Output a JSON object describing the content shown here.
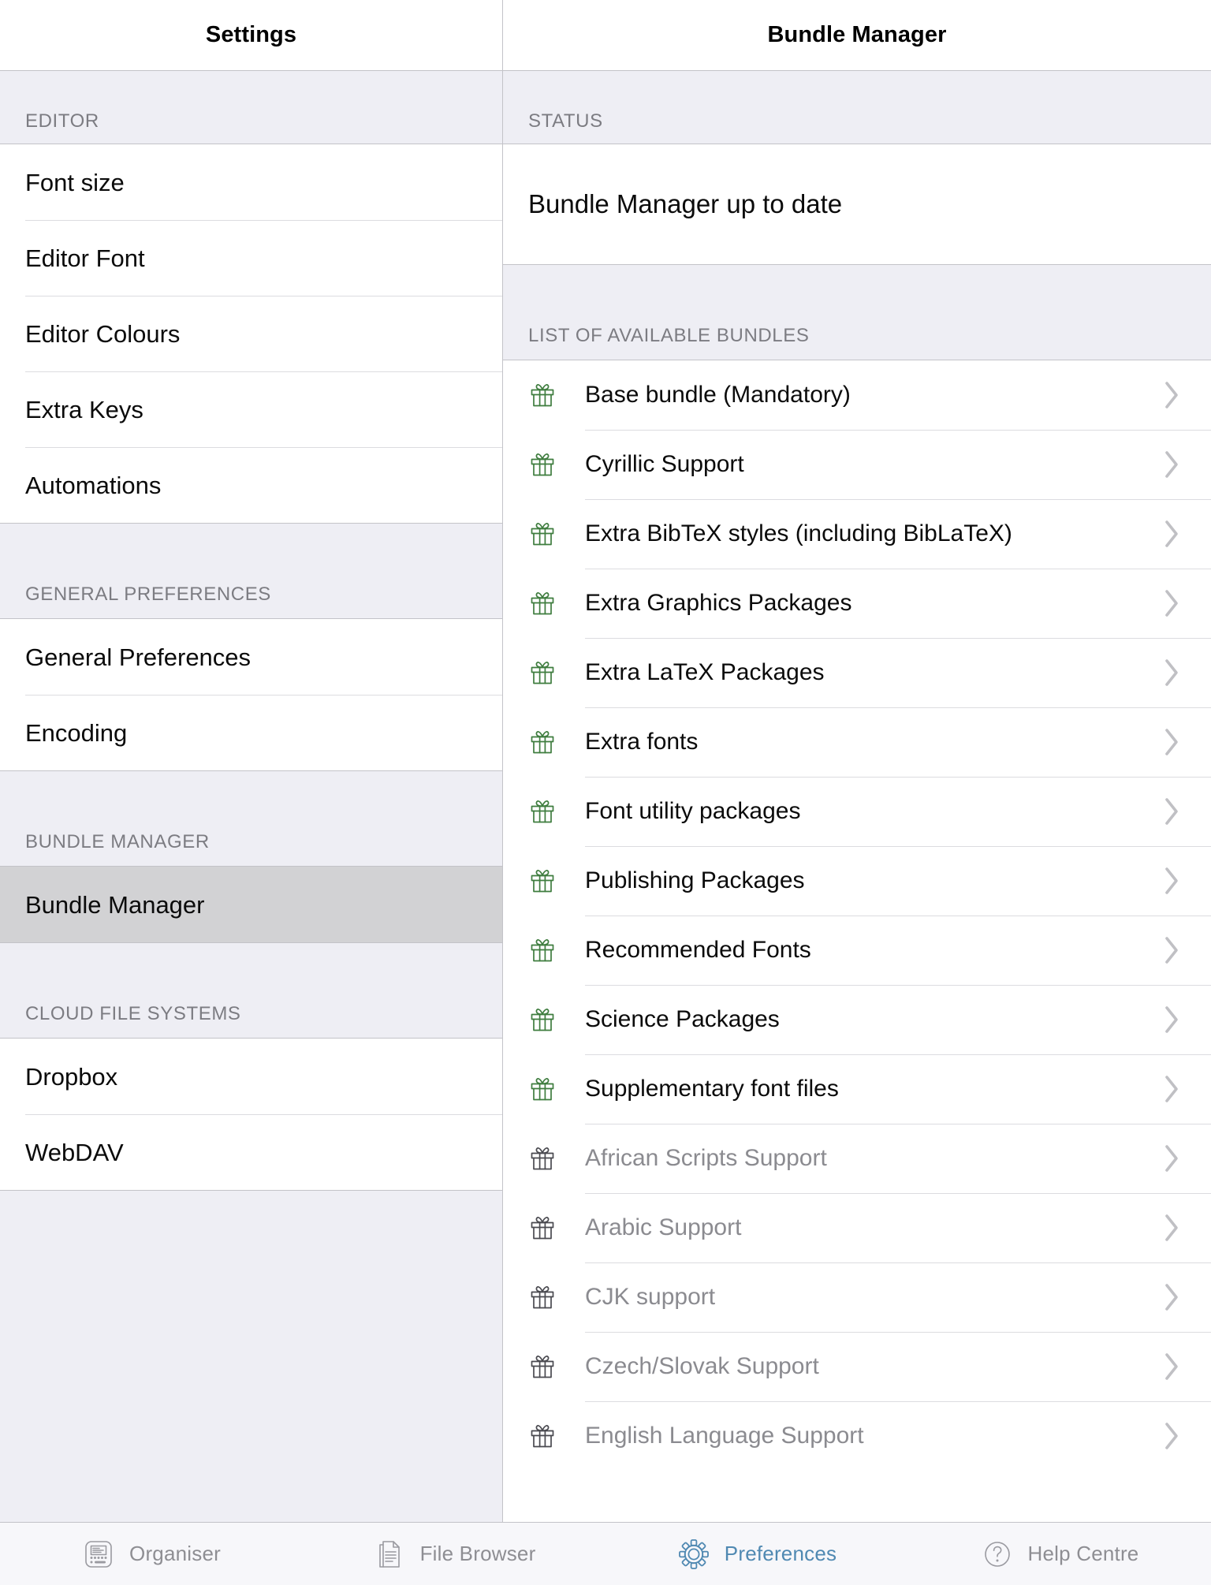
{
  "colors": {
    "accent": "#5089b2",
    "gift_installed": "#3f7d3f",
    "gift_available": "#4a4a50",
    "selected_row": "#d2d2d4",
    "group_bg": "#eeeef4",
    "separator": "#c3c3c8",
    "muted_text": "#8b8b90",
    "section_header_text": "#7c7c82",
    "chevron": "#c0c0c4"
  },
  "left_pane": {
    "nav_title": "Settings",
    "sections": [
      {
        "header": "EDITOR",
        "rows": [
          {
            "label": "Font size",
            "selected": false
          },
          {
            "label": "Editor Font",
            "selected": false
          },
          {
            "label": "Editor Colours",
            "selected": false
          },
          {
            "label": "Extra Keys",
            "selected": false
          },
          {
            "label": "Automations",
            "selected": false
          }
        ]
      },
      {
        "header": "GENERAL PREFERENCES",
        "rows": [
          {
            "label": "General Preferences",
            "selected": false
          },
          {
            "label": "Encoding",
            "selected": false
          }
        ]
      },
      {
        "header": "BUNDLE MANAGER",
        "rows": [
          {
            "label": "Bundle Manager",
            "selected": true
          }
        ]
      },
      {
        "header": "CLOUD FILE SYSTEMS",
        "rows": [
          {
            "label": "Dropbox",
            "selected": false
          },
          {
            "label": "WebDAV",
            "selected": false
          }
        ]
      }
    ]
  },
  "right_pane": {
    "nav_title": "Bundle Manager",
    "status_header": "STATUS",
    "status_text": "Bundle Manager up to date",
    "list_header": "LIST OF AVAILABLE BUNDLES",
    "bundles": [
      {
        "label": "Base bundle (Mandatory)",
        "state": "installed",
        "icon": "gift-icon",
        "chevron": "chevron-right-icon"
      },
      {
        "label": "Cyrillic Support",
        "state": "installed",
        "icon": "gift-icon",
        "chevron": "chevron-right-icon"
      },
      {
        "label": "Extra BibTeX styles (including BibLaTeX)",
        "state": "installed",
        "icon": "gift-icon",
        "chevron": "chevron-right-icon"
      },
      {
        "label": "Extra Graphics Packages",
        "state": "installed",
        "icon": "gift-icon",
        "chevron": "chevron-right-icon"
      },
      {
        "label": "Extra LaTeX Packages",
        "state": "installed",
        "icon": "gift-icon",
        "chevron": "chevron-right-icon"
      },
      {
        "label": "Extra fonts",
        "state": "installed",
        "icon": "gift-icon",
        "chevron": "chevron-right-icon"
      },
      {
        "label": "Font utility packages",
        "state": "installed",
        "icon": "gift-icon",
        "chevron": "chevron-right-icon"
      },
      {
        "label": "Publishing Packages",
        "state": "installed",
        "icon": "gift-icon",
        "chevron": "chevron-right-icon"
      },
      {
        "label": "Recommended Fonts",
        "state": "installed",
        "icon": "gift-icon",
        "chevron": "chevron-right-icon"
      },
      {
        "label": "Science Packages",
        "state": "installed",
        "icon": "gift-icon",
        "chevron": "chevron-right-icon"
      },
      {
        "label": "Supplementary font files",
        "state": "installed",
        "icon": "gift-icon",
        "chevron": "chevron-right-icon"
      },
      {
        "label": "African Scripts Support",
        "state": "available",
        "icon": "gift-icon",
        "chevron": "chevron-right-icon"
      },
      {
        "label": "Arabic Support",
        "state": "available",
        "icon": "gift-icon",
        "chevron": "chevron-right-icon"
      },
      {
        "label": "CJK support",
        "state": "available",
        "icon": "gift-icon",
        "chevron": "chevron-right-icon"
      },
      {
        "label": "Czech/Slovak Support",
        "state": "available",
        "icon": "gift-icon",
        "chevron": "chevron-right-icon"
      },
      {
        "label": "English Language Support",
        "state": "available",
        "icon": "gift-icon",
        "chevron": "chevron-right-icon"
      }
    ]
  },
  "tab_bar": {
    "tabs": [
      {
        "label": "Organiser",
        "icon": "organiser-icon",
        "active": false
      },
      {
        "label": "File Browser",
        "icon": "document-icon",
        "active": false
      },
      {
        "label": "Preferences",
        "icon": "gear-icon",
        "active": true
      },
      {
        "label": "Help Centre",
        "icon": "question-circle-icon",
        "active": false
      }
    ]
  }
}
